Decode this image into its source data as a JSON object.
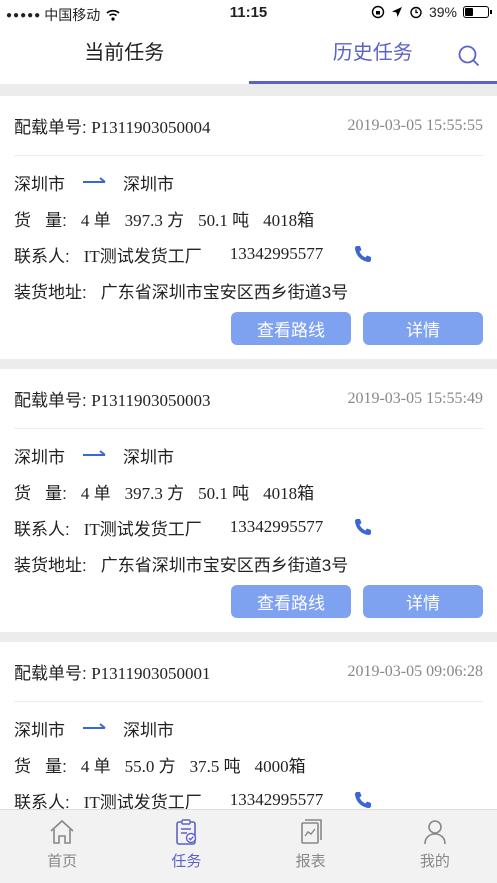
{
  "status_bar": {
    "carrier": "中国移动",
    "time": "11:15",
    "battery": "39%",
    "battery_level": 0.39
  },
  "tabs": {
    "current": "当前任务",
    "history": "历史任务"
  },
  "labels": {
    "order_label": "配载单号:",
    "cargo_label": "货   量:",
    "contact_label": "联系人:",
    "address_label": "装货地址:",
    "view_route": "查看路线",
    "details": "详情"
  },
  "orders": [
    {
      "order_no": "P1311903050004",
      "datetime": "2019-03-05 15:55:55",
      "from": "深圳市",
      "to": "深圳市",
      "orders_count": "4 单",
      "volume": "397.3 方",
      "weight": "50.1 吨",
      "boxes": "4018箱",
      "contact_name": "IT测试发货工厂",
      "contact_phone": "13342995577",
      "address": "广东省深圳市宝安区西乡街道3号"
    },
    {
      "order_no": "P1311903050003",
      "datetime": "2019-03-05 15:55:49",
      "from": "深圳市",
      "to": "深圳市",
      "orders_count": "4 单",
      "volume": "397.3 方",
      "weight": "50.1 吨",
      "boxes": "4018箱",
      "contact_name": "IT测试发货工厂",
      "contact_phone": "13342995577",
      "address": "广东省深圳市宝安区西乡街道3号"
    },
    {
      "order_no": "P1311903050001",
      "datetime": "2019-03-05 09:06:28",
      "from": "深圳市",
      "to": "深圳市",
      "orders_count": "4 单",
      "volume": "55.0 方",
      "weight": "37.5 吨",
      "boxes": "4000箱",
      "contact_name": "IT测试发货工厂",
      "contact_phone": "13342995577"
    }
  ],
  "bottom_nav": {
    "home": "首页",
    "tasks": "任务",
    "reports": "报表",
    "mine": "我的"
  },
  "colors": {
    "accent": "#5b63c9",
    "button": "#7ea2f0",
    "arrow": "#3a66d6"
  }
}
